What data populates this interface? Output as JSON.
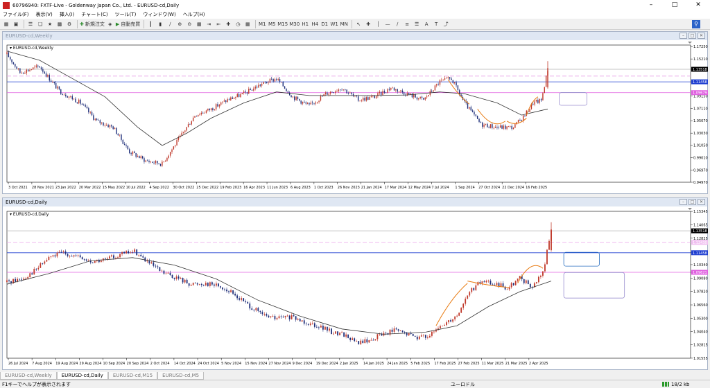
{
  "window": {
    "title": "60796940: FXTF-Live - Goldenway Japan Co., Ltd. - EURUSD-cd,Daily"
  },
  "menu": [
    "ファイル(F)",
    "表示(V)",
    "挿入(I)",
    "チャート(C)",
    "ツール(T)",
    "ウィンドウ(W)",
    "ヘルプ(H)"
  ],
  "toolbar": {
    "new_order_label": "新規注文",
    "auto_trade_label": "自動売買",
    "timeframes": [
      "M1",
      "M5",
      "M15",
      "M30",
      "H1",
      "H4",
      "D1",
      "W1",
      "MN"
    ]
  },
  "status": {
    "help_text": "F1キーでヘルプが表示されます",
    "symbol_text": "ユーロドル",
    "traffic_text": "18/2 kb"
  },
  "tabs": [
    "EURUSD-cd,Weekly",
    "EURUSD-cd,Daily",
    "EURUSD-cd,M15",
    "EURUSD-cd,M5"
  ],
  "active_tab": 1,
  "colors": {
    "bull": "#c0392b",
    "bear": "#1f2f7a",
    "ma": "#333333",
    "fibo": "#e87a10",
    "blue_line": "#1f3fd0",
    "pink_line": "#e060e0",
    "box": "#9a8fd0",
    "box_blue": "#2a6fc0"
  },
  "chart_data": [
    {
      "type": "candlestick",
      "title": "EURUSD-cd,Weekly",
      "window_title": "EURUSD-cd,Weekly",
      "ylim": [
        0.9497,
        1.175
      ],
      "yticks": [
        "1.17250",
        "1.15210",
        "1.13518",
        "1.11458",
        "1.09150",
        "1.07110",
        "1.05070",
        "1.03030",
        "1.01050",
        "0.99010",
        "0.96970",
        "0.94970"
      ],
      "price_labels": [
        {
          "value": 1.13518,
          "text": "1.13518",
          "bg": "#000000",
          "fg": "#ffffff"
        },
        {
          "value": 1.11458,
          "text": "1.11458",
          "bg": "#1f3fd0",
          "fg": "#ffffff"
        },
        {
          "value": 1.09679,
          "text": "1.09679",
          "bg": "#e060e0",
          "fg": "#ffffff"
        }
      ],
      "hlines": [
        {
          "value": 1.13518,
          "color": "#b0b0b0",
          "dash": false
        },
        {
          "value": 1.124,
          "color": "#e8a0e8",
          "dash": true
        },
        {
          "value": 1.11458,
          "color": "#1f3fd0",
          "dash": false
        },
        {
          "value": 1.09679,
          "color": "#e060e0",
          "dash": false
        }
      ],
      "xticks": [
        "3 Oct 2021",
        "28 Nov 2021",
        "23 Jan 2022",
        "20 Mar 2022",
        "15 May 2022",
        "10 Jul 2022",
        "4 Sep 2022",
        "30 Oct 2022",
        "25 Dec 2022",
        "19 Feb 2023",
        "16 Apr 2023",
        "11 Jun 2023",
        "6 Aug 2023",
        "1 Oct 2023",
        "26 Nov 2023",
        "21 Jan 2024",
        "17 Mar 2024",
        "12 May 2024",
        "7 Jul 2024",
        "1 Sep 2024",
        "27 Oct 2024",
        "22 Dec 2024",
        "16 Feb 2025"
      ],
      "path": [
        [
          0,
          1.16
        ],
        [
          8,
          1.13
        ],
        [
          20,
          1.14
        ],
        [
          32,
          1.1
        ],
        [
          45,
          1.08
        ],
        [
          55,
          1.05
        ],
        [
          65,
          1.04
        ],
        [
          75,
          1.0
        ],
        [
          85,
          0.985
        ],
        [
          95,
          0.98
        ],
        [
          105,
          1.02
        ],
        [
          115,
          1.06
        ],
        [
          125,
          1.07
        ],
        [
          135,
          1.085
        ],
        [
          145,
          1.095
        ],
        [
          155,
          1.11
        ],
        [
          165,
          1.12
        ],
        [
          175,
          1.09
        ],
        [
          185,
          1.075
        ],
        [
          195,
          1.095
        ],
        [
          205,
          1.105
        ],
        [
          215,
          1.085
        ],
        [
          225,
          1.09
        ],
        [
          235,
          1.105
        ],
        [
          245,
          1.095
        ],
        [
          255,
          1.085
        ],
        [
          265,
          1.115
        ],
        [
          272,
          1.12
        ],
        [
          280,
          1.08
        ],
        [
          290,
          1.045
        ],
        [
          300,
          1.04
        ],
        [
          310,
          1.04
        ],
        [
          317,
          1.06
        ],
        [
          322,
          1.08
        ],
        [
          327,
          1.084
        ],
        [
          331,
          1.135
        ]
      ],
      "ma_path": [
        [
          0,
          1.165
        ],
        [
          20,
          1.15
        ],
        [
          40,
          1.12
        ],
        [
          60,
          1.09
        ],
        [
          80,
          1.04
        ],
        [
          95,
          1.01
        ],
        [
          110,
          1.03
        ],
        [
          125,
          1.055
        ],
        [
          145,
          1.08
        ],
        [
          165,
          1.098
        ],
        [
          185,
          1.092
        ],
        [
          205,
          1.092
        ],
        [
          225,
          1.092
        ],
        [
          245,
          1.093
        ],
        [
          265,
          1.098
        ],
        [
          280,
          1.095
        ],
        [
          300,
          1.08
        ],
        [
          315,
          1.06
        ],
        [
          331,
          1.07
        ]
      ],
      "annotations": [
        {
          "kind": "fibo_arc",
          "points": [
            [
              270,
              1.118
            ],
            [
              277,
              1.09
            ],
            [
              283,
              1.078
            ]
          ]
        },
        {
          "kind": "fibo_arc",
          "points": [
            [
              288,
              1.07
            ],
            [
              297,
              1.035
            ],
            [
              305,
              1.05
            ]
          ]
        },
        {
          "kind": "fibo_arc",
          "points": [
            [
              306,
              1.05
            ],
            [
              312,
              1.04
            ],
            [
              318,
              1.055
            ]
          ]
        },
        {
          "kind": "fibo_arc",
          "points": [
            [
              318,
              1.06
            ],
            [
              321,
              1.083
            ],
            [
              325,
              1.09
            ]
          ]
        }
      ],
      "boxes": [
        {
          "x1": 338,
          "x2": 355,
          "y1": 1.097,
          "y2": 1.076,
          "color": "#9a8fd0"
        }
      ]
    },
    {
      "type": "candlestick",
      "title": "EURUSD-cd,Daily",
      "window_title": "EURUSD-cd,Daily",
      "ylim": [
        1.0155,
        1.1535
      ],
      "yticks": [
        "1.15345",
        "1.14065",
        "1.13518",
        "1.12825",
        "1.11458",
        "1.10340",
        "1.09621",
        "1.09080",
        "1.07820",
        "1.06560",
        "1.05300",
        "1.04040",
        "1.02815",
        "1.01555"
      ],
      "price_labels": [
        {
          "value": 1.13518,
          "text": "1.13518",
          "bg": "#000000",
          "fg": "#ffffff"
        },
        {
          "value": 1.1243,
          "text": "1.12430",
          "bg": "#f0c0f0",
          "fg": "#ffffff"
        },
        {
          "value": 1.11458,
          "text": "1.11458",
          "bg": "#1f3fd0",
          "fg": "#ffffff"
        },
        {
          "value": 1.09621,
          "text": "1.09621",
          "bg": "#e060e0",
          "fg": "#ffffff"
        }
      ],
      "hlines": [
        {
          "value": 1.13518,
          "color": "#b0b0b0",
          "dash": false
        },
        {
          "value": 1.1243,
          "color": "#e8a0e8",
          "dash": true
        },
        {
          "value": 1.11458,
          "color": "#1f3fd0",
          "dash": false
        },
        {
          "value": 1.09621,
          "color": "#e060e0",
          "dash": false
        }
      ],
      "xticks": [
        "26 Jul 2024",
        "7 Aug 2024",
        "19 Aug 2024",
        "29 Aug 2024",
        "10 Sep 2024",
        "20 Sep 2024",
        "2 Oct 2024",
        "14 Oct 2024",
        "24 Oct 2024",
        "5 Nov 2024",
        "15 Nov 2024",
        "27 Nov 2024",
        "9 Dec 2024",
        "19 Dec 2024",
        "2 Jan 2025",
        "14 Jan 2025",
        "24 Jan 2025",
        "5 Feb 2025",
        "17 Feb 2025",
        "27 Feb 2025",
        "11 Mar 2025",
        "21 Mar 2025",
        "2 Apr 2025"
      ],
      "path": [
        [
          0,
          1.087
        ],
        [
          8,
          1.091
        ],
        [
          14,
          1.099
        ],
        [
          20,
          1.11
        ],
        [
          27,
          1.115
        ],
        [
          33,
          1.111
        ],
        [
          40,
          1.106
        ],
        [
          47,
          1.108
        ],
        [
          54,
          1.113
        ],
        [
          61,
          1.116
        ],
        [
          67,
          1.106
        ],
        [
          74,
          1.096
        ],
        [
          81,
          1.091
        ],
        [
          88,
          1.085
        ],
        [
          95,
          1.086
        ],
        [
          101,
          1.084
        ],
        [
          108,
          1.076
        ],
        [
          115,
          1.066
        ],
        [
          122,
          1.056
        ],
        [
          128,
          1.053
        ],
        [
          135,
          1.054
        ],
        [
          142,
          1.05
        ],
        [
          149,
          1.046
        ],
        [
          155,
          1.04
        ],
        [
          161,
          1.038
        ],
        [
          167,
          1.03
        ],
        [
          173,
          1.032
        ],
        [
          179,
          1.038
        ],
        [
          185,
          1.042
        ],
        [
          191,
          1.038
        ],
        [
          197,
          1.035
        ],
        [
          203,
          1.038
        ],
        [
          209,
          1.048
        ],
        [
          215,
          1.056
        ],
        [
          221,
          1.078
        ],
        [
          227,
          1.088
        ],
        [
          233,
          1.085
        ],
        [
          239,
          1.082
        ],
        [
          245,
          1.091
        ],
        [
          251,
          1.082
        ],
        [
          256,
          1.096
        ],
        [
          260,
          1.135
        ]
      ],
      "ma_path": [
        [
          0,
          1.085
        ],
        [
          20,
          1.095
        ],
        [
          40,
          1.107
        ],
        [
          60,
          1.11
        ],
        [
          80,
          1.103
        ],
        [
          100,
          1.09
        ],
        [
          120,
          1.07
        ],
        [
          140,
          1.055
        ],
        [
          160,
          1.043
        ],
        [
          180,
          1.038
        ],
        [
          200,
          1.04
        ],
        [
          215,
          1.046
        ],
        [
          230,
          1.064
        ],
        [
          245,
          1.078
        ],
        [
          260,
          1.088
        ]
      ],
      "annotations": [
        {
          "kind": "fibo_arc",
          "points": [
            [
              205,
              1.046
            ],
            [
              212,
              1.072
            ],
            [
              220,
              1.086
            ]
          ]
        },
        {
          "kind": "fibo_arc",
          "points": [
            [
              220,
              1.088
            ],
            [
              232,
              1.083
            ],
            [
              240,
              1.082
            ]
          ]
        },
        {
          "kind": "fibo_arc",
          "points": [
            [
              244,
              1.086
            ],
            [
              250,
              1.109
            ],
            [
              256,
              1.1
            ]
          ]
        }
      ],
      "boxes": [
        {
          "x1": 266,
          "x2": 283,
          "y1": 1.115,
          "y2": 1.102,
          "color": "#2a6fc0"
        },
        {
          "x1": 266,
          "x2": 295,
          "y1": 1.096,
          "y2": 1.072,
          "color": "#9a8fd0"
        }
      ]
    }
  ]
}
